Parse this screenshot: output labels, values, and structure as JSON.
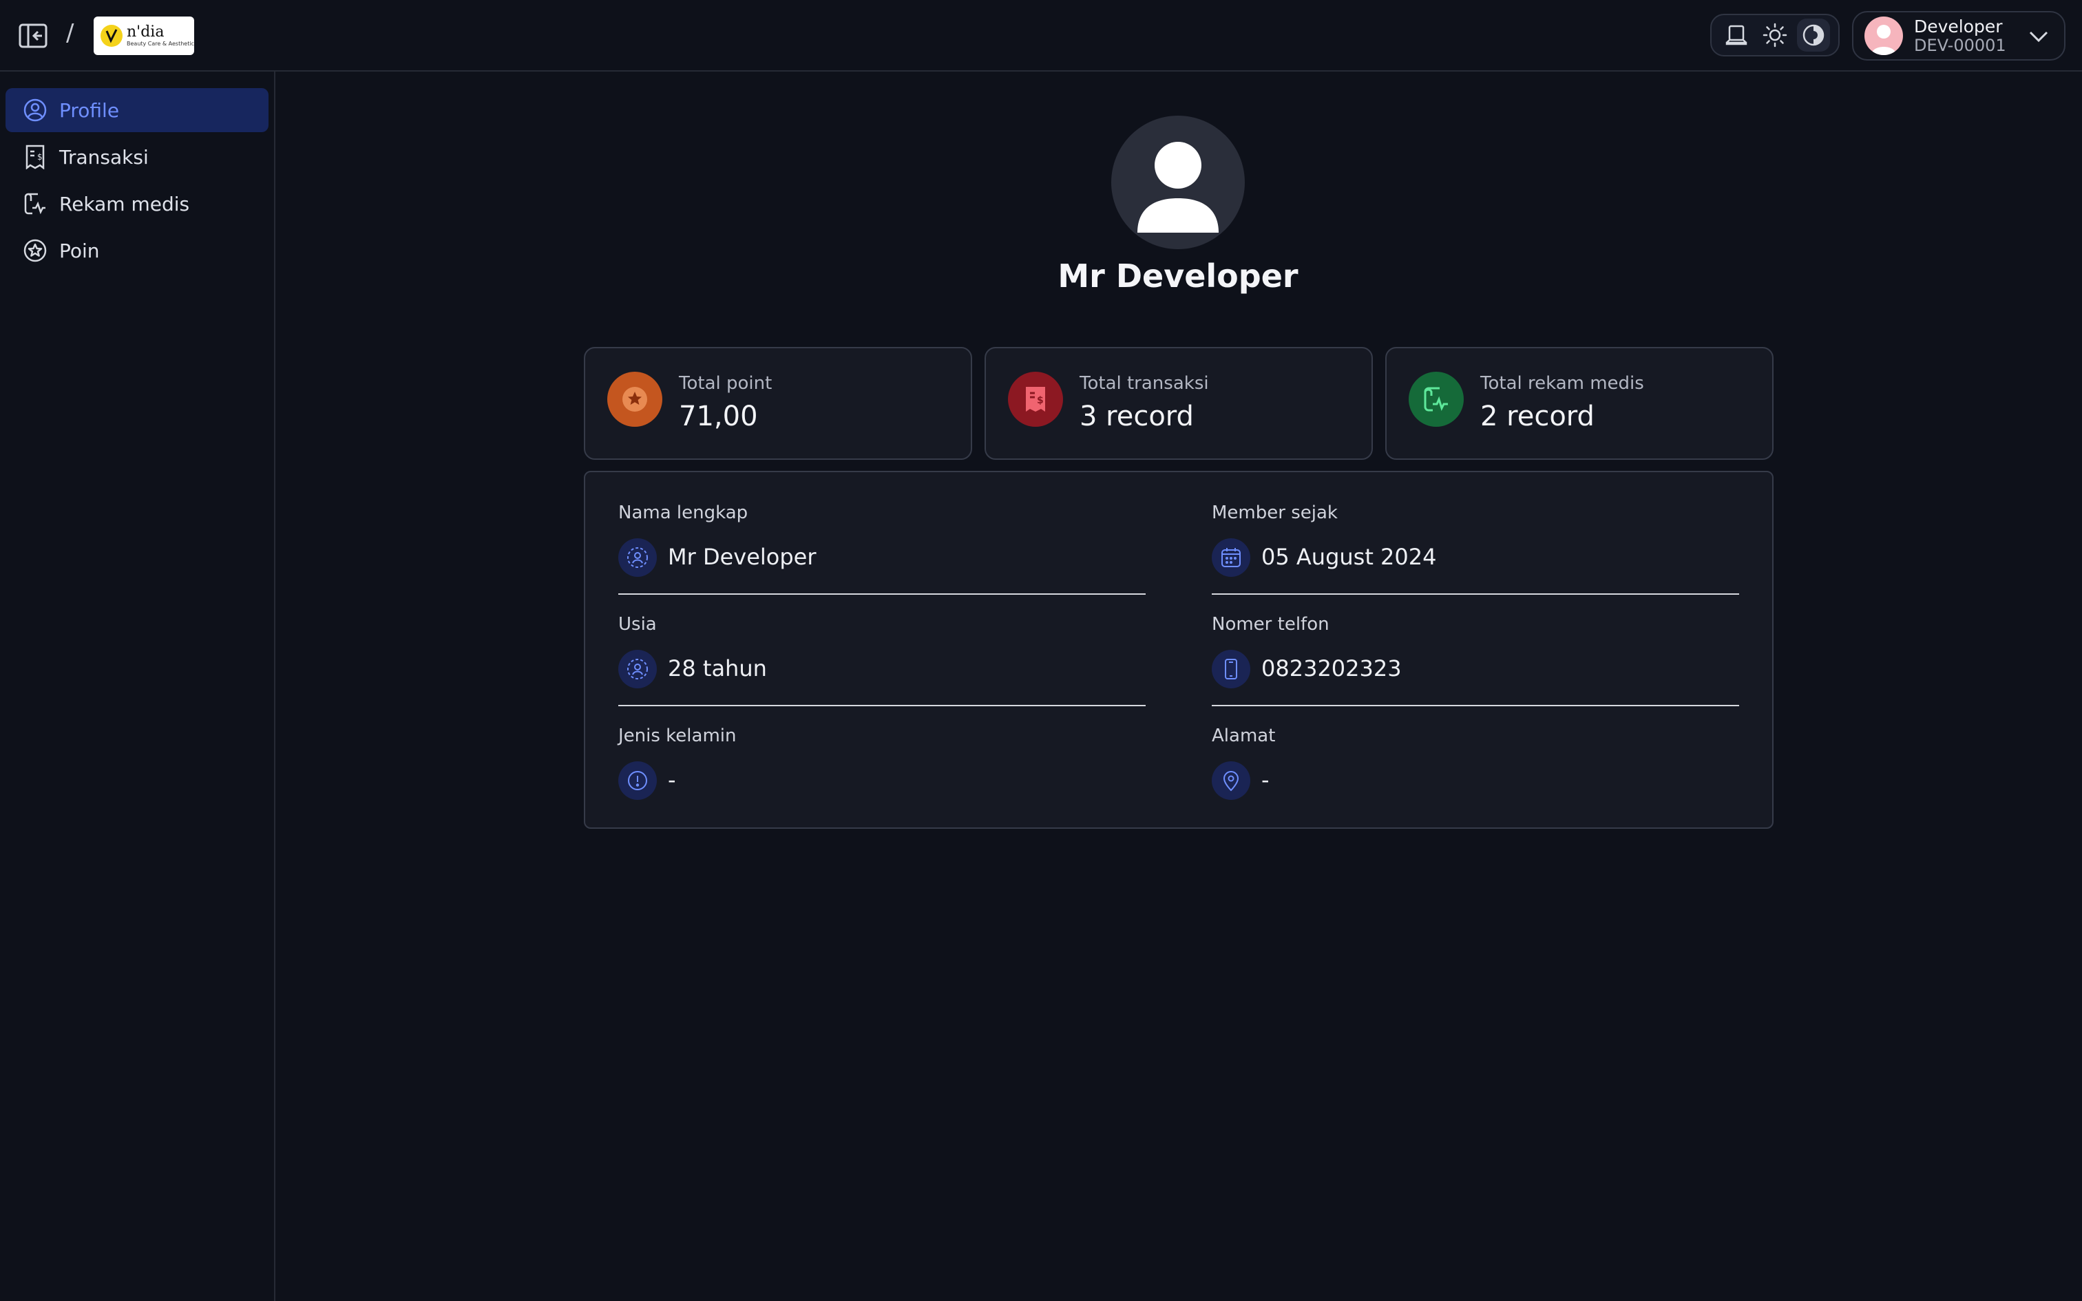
{
  "header": {
    "breadcrumb_separator": "/",
    "logo_text": "n'dia",
    "logo_tagline": "Beauty Care & Aesthetic",
    "theme_options": [
      "system-icon",
      "sun-icon",
      "contrast-icon"
    ],
    "active_theme": "contrast",
    "user": {
      "name": "Developer",
      "id": "DEV-00001"
    }
  },
  "sidebar": {
    "items": [
      {
        "label": "Profile",
        "icon": "user-circle-icon",
        "active": true
      },
      {
        "label": "Transaksi",
        "icon": "receipt-icon",
        "active": false
      },
      {
        "label": "Rekam medis",
        "icon": "medical-record-icon",
        "active": false
      },
      {
        "label": "Poin",
        "icon": "star-badge-icon",
        "active": false
      }
    ]
  },
  "profile": {
    "name": "Mr Developer"
  },
  "stats": [
    {
      "label": "Total point",
      "value": "71,00",
      "icon": "star-icon",
      "color": "#c4561f"
    },
    {
      "label": "Total transaksi",
      "value": "3 record",
      "icon": "receipt-icon",
      "color": "#8c1822"
    },
    {
      "label": "Total rekam medis",
      "value": "2 record",
      "icon": "medical-record-icon",
      "color": "#156a39"
    }
  ],
  "details": {
    "nama_lengkap": {
      "label": "Nama lengkap",
      "value": "Mr Developer"
    },
    "member_sejak": {
      "label": "Member sejak",
      "value": "05 August 2024"
    },
    "usia": {
      "label": "Usia",
      "value": "28 tahun"
    },
    "nomer_telfon": {
      "label": "Nomer telfon",
      "value": "0823202323"
    },
    "jenis_kelamin": {
      "label": "Jenis kelamin",
      "value": "-"
    },
    "alamat": {
      "label": "Alamat",
      "value": "-"
    }
  },
  "colors": {
    "background": "#0e111a",
    "accent": "#6f8fff",
    "active_nav_bg": "#17265e",
    "card_bg": "#161923"
  }
}
